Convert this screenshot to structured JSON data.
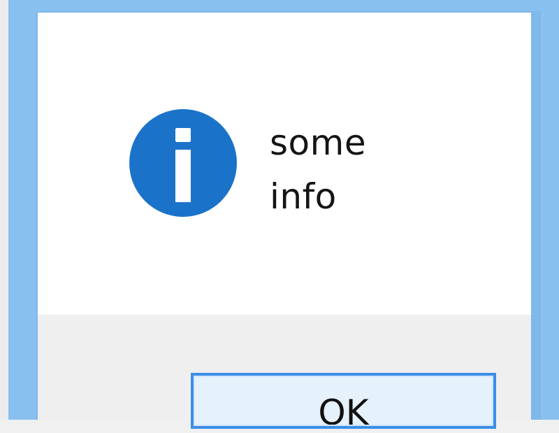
{
  "dialog": {
    "icon": "info-icon",
    "icon_color": "#1b73c9",
    "message_lines": [
      "some",
      "info"
    ],
    "ok_label": "OK"
  },
  "colors": {
    "frame": "#88c0f0",
    "button_border": "#3c8ee6",
    "button_bar": "#efefef"
  }
}
